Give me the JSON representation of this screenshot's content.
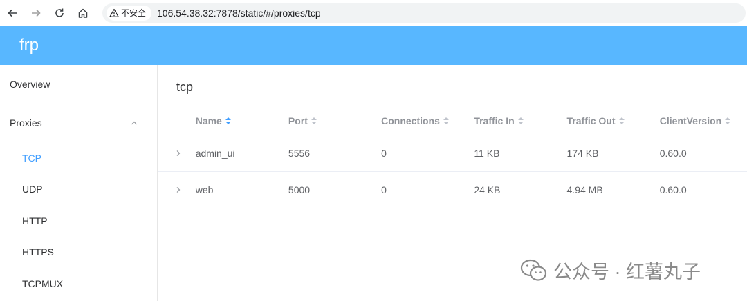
{
  "browser": {
    "security_label": "不安全",
    "url": "106.54.38.32:7878/static/#/proxies/tcp"
  },
  "header": {
    "brand": "frp"
  },
  "sidebar": {
    "overview": "Overview",
    "proxies": "Proxies",
    "sub_items": [
      "TCP",
      "UDP",
      "HTTP",
      "HTTPS",
      "TCPMUX"
    ],
    "active_sub": "TCP"
  },
  "main": {
    "title": "tcp"
  },
  "table": {
    "columns": [
      "Name",
      "Port",
      "Connections",
      "Traffic In",
      "Traffic Out",
      "ClientVersion"
    ],
    "rows": [
      [
        "admin_ui",
        "5556",
        "0",
        "11 KB",
        "174 KB",
        "0.60.0"
      ],
      [
        "web",
        "5000",
        "0",
        "24 KB",
        "4.94 MB",
        "0.60.0"
      ]
    ]
  },
  "watermark": {
    "text": "公众号 · 红薯丸子"
  },
  "colors": {
    "header_bg": "#58b7ff",
    "active": "#409eff"
  }
}
